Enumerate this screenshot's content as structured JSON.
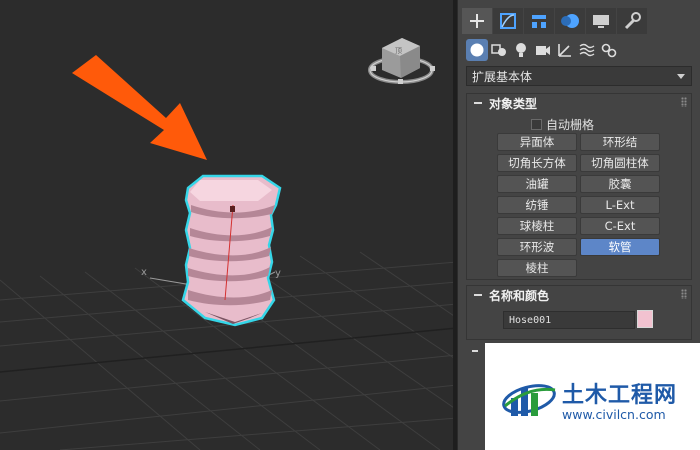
{
  "viewport": {
    "axis_x_label": "x",
    "axis_y_label": "y",
    "viewcube_face": "顶",
    "object_color": "#f0c8d4",
    "selection_color": "#35d6e8",
    "arrow_color": "#ff5a0a"
  },
  "command_panel": {
    "tabs": [
      "create-icon",
      "modify-icon",
      "hierarchy-icon",
      "motion-icon",
      "display-icon",
      "utilities-icon"
    ],
    "categories": [
      "geometry-icon",
      "shapes-icon",
      "lights-icon",
      "cameras-icon",
      "helpers-icon",
      "spacewarps-icon",
      "systems-icon"
    ],
    "dropdown_value": "扩展基本体"
  },
  "object_type": {
    "title": "对象类型",
    "autogrid_label": "自动栅格",
    "buttons": [
      "异面体",
      "环形结",
      "切角长方体",
      "切角圆柱体",
      "油罐",
      "胶囊",
      "纺锤",
      "L-Ext",
      "球棱柱",
      "C-Ext",
      "环形波",
      "软管",
      "棱柱"
    ],
    "active_button": "软管"
  },
  "name_color": {
    "title": "名称和颜色",
    "name_value": "Hose001",
    "color_hex": "#f2c2d0"
  },
  "watermark": {
    "title": "土木工程网",
    "url": "www.civilcn.com"
  }
}
